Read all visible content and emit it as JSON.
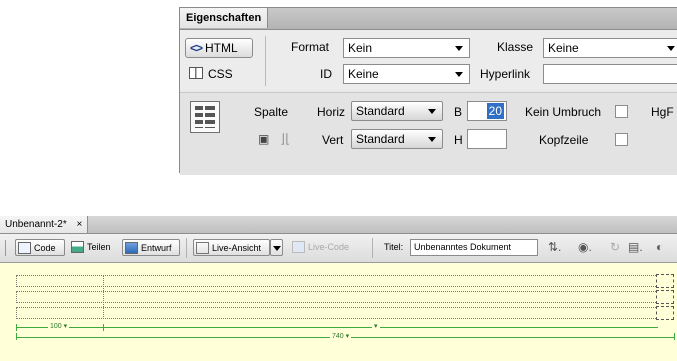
{
  "properties_panel": {
    "tab_title": "Eigenschaften",
    "html_button": "HTML",
    "css_button": "CSS",
    "format_label": "Format",
    "format_value": "Kein",
    "klasse_label": "Klasse",
    "klasse_value": "Keine",
    "id_label": "ID",
    "id_value": "Keine",
    "hyperlink_label": "Hyperlink",
    "spalte_label": "Spalte",
    "horiz_label": "Horiz",
    "horiz_value": "Standard",
    "vert_label": "Vert",
    "vert_value": "Standard",
    "b_label": "B",
    "b_value": "20",
    "h_label": "H",
    "kein_umbruch_label": "Kein Umbruch",
    "kopfzeile_label": "Kopfzeile",
    "hgf_label": "HgF"
  },
  "document": {
    "tab_title": "Unbenannt-2*",
    "tab_close": "×",
    "toolbar": {
      "code": "Code",
      "teilen": "Teilen",
      "entwurf": "Entwurf",
      "live_ansicht": "Live-Ansicht",
      "live_code": "Live-Code",
      "titel_label": "Titel:",
      "titel_value": "Unbenanntes Dokument"
    },
    "width_left": "100",
    "width_total": "740"
  },
  "colors": {
    "canvas_bg": "#ffffd8",
    "measure_green": "#3fa83f",
    "selection_blue": "#2f6fc6"
  }
}
